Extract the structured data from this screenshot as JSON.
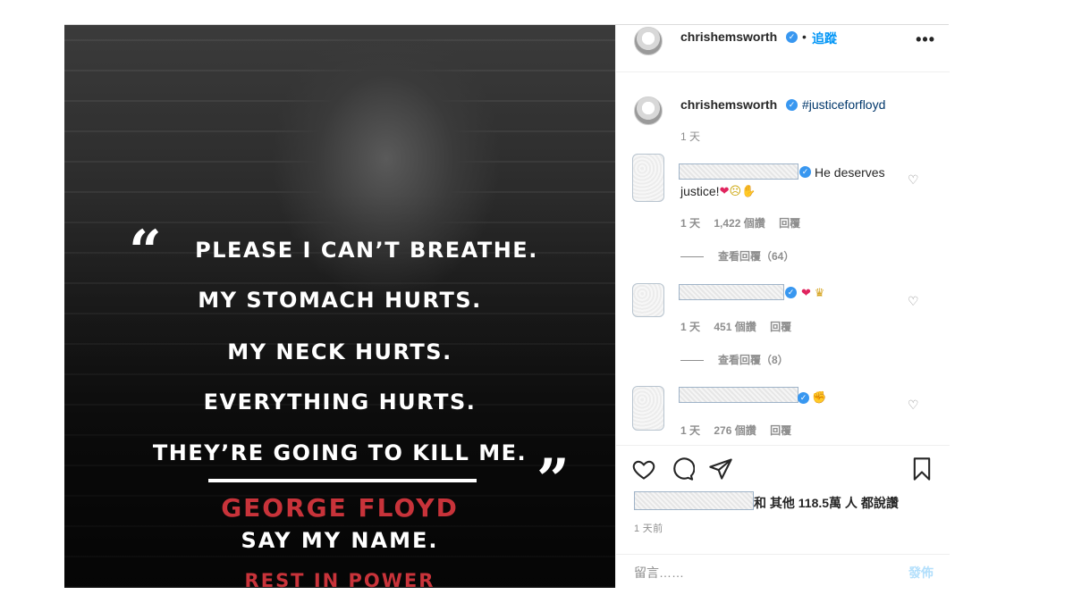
{
  "image": {
    "quote_lines": [
      "PLEASE I CAN’T BREATHE.",
      "MY STOMACH HURTS.",
      "MY NECK HURTS.",
      "EVERYTHING HURTS.",
      "THEY’RE GOING TO KILL ME."
    ],
    "open_quote": "“",
    "close_quote": "”",
    "name": "GEORGE FLOYD",
    "say_name": "SAY MY NAME.",
    "rest": "REST IN POWER"
  },
  "header": {
    "username": "chrishemsworth",
    "dot": "•",
    "follow_label": "追蹤",
    "more": "•••"
  },
  "caption": {
    "username": "chrishemsworth",
    "text": "#justiceforfloyd",
    "time": "1 天"
  },
  "comments": [
    {
      "text_line1": "He deserves",
      "text_line2": "justice!",
      "time": "1 天",
      "likes": "1,422 個讚",
      "reply": "回覆",
      "view_replies": "查看回覆（64）"
    },
    {
      "time": "1 天",
      "likes": "451 個讚",
      "reply": "回覆",
      "view_replies": "查看回覆（8）"
    },
    {
      "time": "1 天",
      "likes": "276 個讚",
      "reply": "回覆"
    }
  ],
  "likes_summary": "和 其他 118.5萬 人 都說讚",
  "posted_ago": "1 天前",
  "comment_placeholder": "留言……",
  "post_button": "發佈",
  "colors": {
    "accent": "#0095f6",
    "name_red": "#c8333a",
    "verified": "#3897f0"
  },
  "icons": [
    "heart-icon",
    "comment-icon",
    "share-icon",
    "bookmark-icon",
    "verified-badge-icon",
    "more-options-icon"
  ]
}
